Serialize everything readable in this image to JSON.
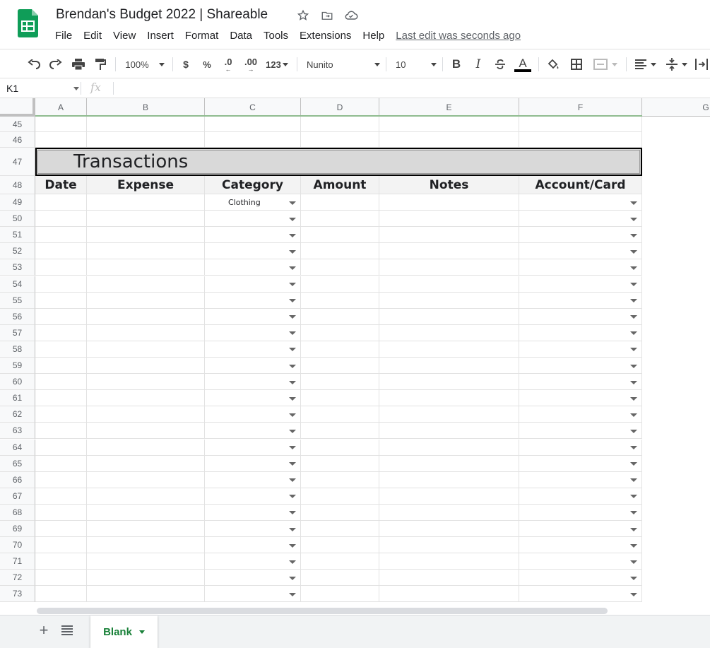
{
  "app": {
    "doc_title": "Brendan's Budget 2022 | Shareable",
    "menu": [
      "File",
      "Edit",
      "View",
      "Insert",
      "Format",
      "Data",
      "Tools",
      "Extensions",
      "Help"
    ],
    "last_edit": "Last edit was seconds ago"
  },
  "toolbar": {
    "zoom": "100%",
    "currency": "$",
    "percent": "%",
    "decrease_decimal": ".0",
    "increase_decimal": ".00",
    "more_formats": "123",
    "font": "Nunito",
    "font_size": "10",
    "bold": "B",
    "italic": "I",
    "text_color": "A"
  },
  "formula_bar": {
    "name_box": "K1",
    "fx": "fx"
  },
  "columns": [
    "A",
    "B",
    "C",
    "D",
    "E",
    "F",
    "G"
  ],
  "rows": [
    "45",
    "46",
    "47",
    "48",
    "49",
    "50",
    "51",
    "52",
    "53",
    "54",
    "55",
    "56",
    "57",
    "58",
    "59",
    "60",
    "61",
    "62",
    "63",
    "64",
    "65",
    "66",
    "67",
    "68",
    "69",
    "70",
    "71",
    "72",
    "73"
  ],
  "sheet": {
    "section_title": "Transactions",
    "headers": [
      "Date",
      "Expense",
      "Category",
      "Amount",
      "Notes",
      "Account/Card"
    ],
    "first_category": "Clothing"
  },
  "bottom": {
    "add_sheet": "+",
    "active_tab": "Blank"
  },
  "colors": {
    "brand_green": "#188038",
    "header_fill": "#d9d9d9",
    "grid_line": "#e2e2e2"
  }
}
